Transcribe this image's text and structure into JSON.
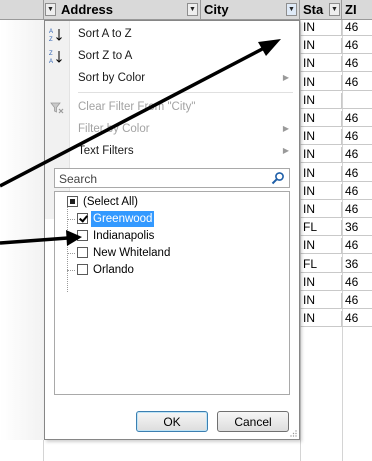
{
  "headers": {
    "address": "Address",
    "city": "City",
    "state": "Sta",
    "zip": "ZI"
  },
  "menu": {
    "sort_az": "Sort A to Z",
    "sort_za": "Sort Z to A",
    "sort_color": "Sort by Color",
    "clear_filter": "Clear Filter From \"City\"",
    "filter_color": "Filter by Color",
    "text_filters": "Text Filters"
  },
  "search": {
    "placeholder": "Search"
  },
  "list": {
    "select_all": "(Select All)",
    "items": [
      {
        "label": "Greenwood",
        "checked": true
      },
      {
        "label": "Indianapolis",
        "checked": false
      },
      {
        "label": "New Whiteland",
        "checked": false
      },
      {
        "label": "Orlando",
        "checked": false
      }
    ]
  },
  "buttons": {
    "ok": "OK",
    "cancel": "Cancel"
  },
  "rows": [
    {
      "state": "IN",
      "zip": "46"
    },
    {
      "state": "IN",
      "zip": "46"
    },
    {
      "state": "IN",
      "zip": "46"
    },
    {
      "state": "IN",
      "zip": "46"
    },
    {
      "state": "IN",
      "zip": ""
    },
    {
      "state": "IN",
      "zip": "46"
    },
    {
      "state": "IN",
      "zip": "46"
    },
    {
      "state": "IN",
      "zip": "46"
    },
    {
      "state": "IN",
      "zip": "46"
    },
    {
      "state": "IN",
      "zip": "46"
    },
    {
      "state": "IN",
      "zip": "46"
    },
    {
      "state": "FL",
      "zip": "36"
    },
    {
      "state": "IN",
      "zip": "46"
    },
    {
      "state": "FL",
      "zip": "36"
    },
    {
      "state": "IN",
      "zip": "46"
    },
    {
      "state": "IN",
      "zip": "46"
    },
    {
      "state": "IN",
      "zip": "46"
    }
  ],
  "colors": {
    "selection": "#3399ff",
    "header_bg": "#d9d9d9",
    "arrow": "#000000"
  }
}
